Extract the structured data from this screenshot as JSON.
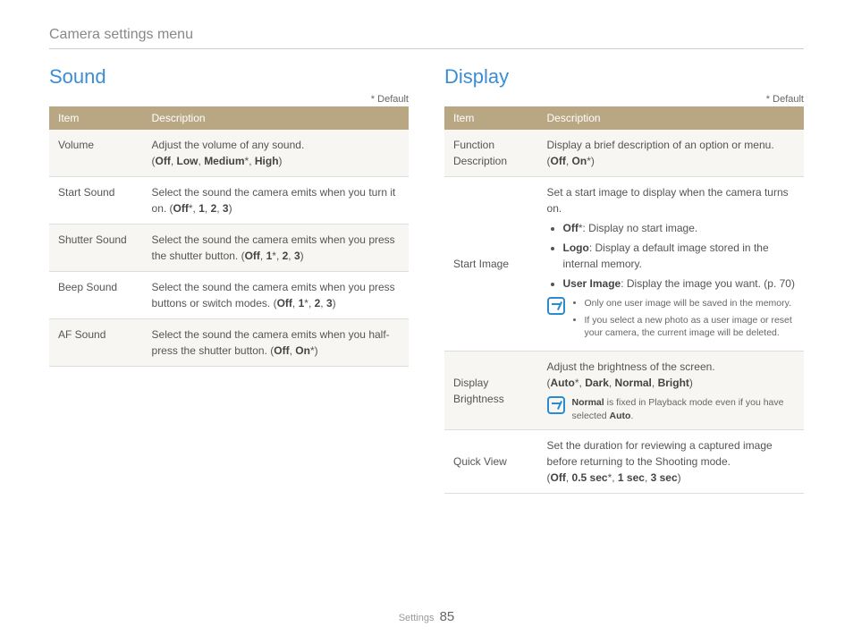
{
  "page": {
    "breadcrumb": "Camera settings menu",
    "footer_label": "Settings",
    "page_number": "85",
    "default_marker": "* Default"
  },
  "sound": {
    "title": "Sound",
    "headers": {
      "item": "Item",
      "desc": "Description"
    },
    "rows": {
      "volume": {
        "item": "Volume",
        "desc_line1": "Adjust the volume of any sound.",
        "opts_open": "(",
        "o1": "Off",
        "c1": ", ",
        "o2": "Low",
        "c2": ", ",
        "o3": "Medium",
        "o3s": "*",
        "c3": ", ",
        "o4": "High",
        "opts_close": ")"
      },
      "start": {
        "item": "Start Sound",
        "desc": "Select the sound the camera emits when you turn it on. (",
        "o1": "Off",
        "o1s": "*",
        "c1": ", ",
        "o2": "1",
        "c2": ", ",
        "o3": "2",
        "c3": ", ",
        "o4": "3",
        "close": ")"
      },
      "shutter": {
        "item": "Shutter Sound",
        "desc": "Select the sound the camera emits when you press the shutter button. (",
        "o1": "Off",
        "c1": ", ",
        "o2": "1",
        "o2s": "*",
        "c2": ", ",
        "o3": "2",
        "c3": ", ",
        "o4": "3",
        "close": ")"
      },
      "beep": {
        "item": "Beep Sound",
        "desc": "Select the sound the camera emits when you press buttons or switch modes. (",
        "o1": "Off",
        "c1": ", ",
        "o2": "1",
        "o2s": "*",
        "c2": ", ",
        "o3": "2",
        "c3": ", ",
        "o4": "3",
        "close": ")"
      },
      "af": {
        "item": "AF Sound",
        "desc": "Select the sound the camera emits when you half-press the shutter button. (",
        "o1": "Off",
        "c1": ", ",
        "o2": "On",
        "o2s": "*",
        "close": ")"
      }
    }
  },
  "display": {
    "title": "Display",
    "headers": {
      "item": "Item",
      "desc": "Description"
    },
    "rows": {
      "func": {
        "item": "Function Description",
        "desc": "Display a brief description of an option or menu.",
        "open": "(",
        "o1": "Off",
        "c1": ", ",
        "o2": "On",
        "o2s": "*",
        "close": ")"
      },
      "startimg": {
        "item": "Start Image",
        "desc": "Set a start image to display when the camera turns on.",
        "li1a": "Off",
        "li1s": "*",
        "li1b": ": Display no start image.",
        "li2a": "Logo",
        "li2b": ": Display a default image stored in the internal memory.",
        "li3a": "User Image",
        "li3b": ": Display the image you want. (p. 70)",
        "note1": "Only one user image will be saved in the memory.",
        "note2": "If you select a new photo as a user image or reset your camera, the current image will be deleted."
      },
      "bright": {
        "item": "Display Brightness",
        "desc": "Adjust the brightness of the screen.",
        "open": "(",
        "o1": "Auto",
        "o1s": "*",
        "c1": ", ",
        "o2": "Dark",
        "c2": ", ",
        "o3": "Normal",
        "c3": ", ",
        "o4": "Bright",
        "close": ")",
        "note_b1": "Normal",
        "note_rest": " is fixed in Playback mode even if you have selected ",
        "note_b2": "Auto",
        "note_end": "."
      },
      "quick": {
        "item": "Quick View",
        "desc": "Set the duration for reviewing a captured image before returning to the Shooting mode.",
        "open": "(",
        "o1": "Off",
        "c1": ", ",
        "o2": "0.5 sec",
        "o2s": "*",
        "c2": ", ",
        "o3": "1 sec",
        "c3": ", ",
        "o4": "3 sec",
        "close": ")"
      }
    }
  }
}
